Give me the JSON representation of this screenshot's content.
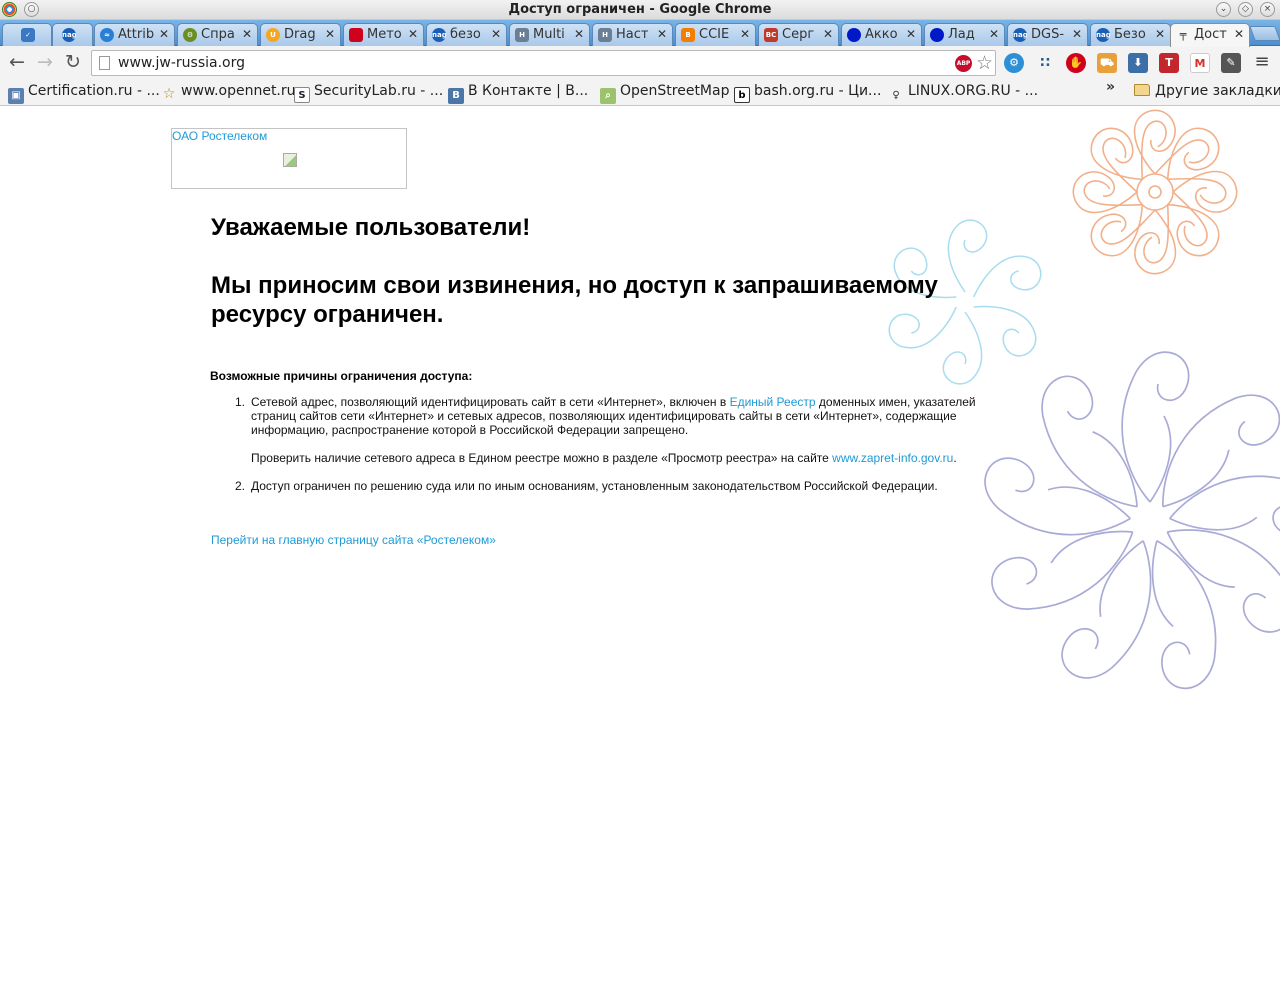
{
  "window": {
    "title": "Доступ ограничен - Google Chrome"
  },
  "tabs": [
    {
      "label": "",
      "icon": "checkmark-icon",
      "color": "#3b78c4"
    },
    {
      "label": "",
      "icon": "nagios-icon",
      "color": "#1a5fb4"
    },
    {
      "label": "Attrib",
      "icon": "wave-icon",
      "color": "#2a7fd4"
    },
    {
      "label": "Спра",
      "icon": "gear-icon",
      "color": "#6b8e23"
    },
    {
      "label": "Drag",
      "icon": "u-icon",
      "color": "#f5a623"
    },
    {
      "label": "Мето",
      "icon": "red-square-icon",
      "color": "#d0021b"
    },
    {
      "label": "безо",
      "icon": "nagios-icon",
      "color": "#1a5fb4"
    },
    {
      "label": "Multi",
      "icon": "h-icon",
      "color": "#6a7f96"
    },
    {
      "label": "Наст",
      "icon": "h-icon",
      "color": "#6a7f96"
    },
    {
      "label": "CCIE",
      "icon": "blogger-icon",
      "color": "#f57d00"
    },
    {
      "label": "Серг",
      "icon": "vc-icon",
      "color": "#c0392b"
    },
    {
      "label": "Акко",
      "icon": "blue-circle-icon",
      "color": "#0019c8"
    },
    {
      "label": "Лад",
      "icon": "blue-circle-icon",
      "color": "#0019c8"
    },
    {
      "label": "DGS-",
      "icon": "nagios-icon",
      "color": "#1a5fb4"
    },
    {
      "label": "Безо",
      "icon": "nagios-icon",
      "color": "#1a5fb4"
    },
    {
      "label": "Дост",
      "icon": "rostelecom-icon",
      "color": "#333333",
      "active": true
    }
  ],
  "toolbar": {
    "url": "www.jw-russia.org",
    "abp_label": "ABP"
  },
  "bookmarks": [
    {
      "label": "Certification.ru - ...",
      "icon": "cert-icon"
    },
    {
      "label": "www.opennet.ru",
      "icon": "star-icon"
    },
    {
      "label": "SecurityLab.ru - ...",
      "icon": "securitylab-icon"
    },
    {
      "label": "В Контакте | В...",
      "icon": "vk-icon"
    },
    {
      "label": "OpenStreetMap",
      "icon": "osm-icon"
    },
    {
      "label": "bash.org.ru - Ци...",
      "icon": "bash-icon"
    },
    {
      "label": "LINUX.ORG.RU - ...",
      "icon": "linux-icon"
    }
  ],
  "bookmarks_overflow": "»",
  "other_bookmarks": "Другие закладки",
  "page": {
    "logo_alt": "ОАО Ростелеком",
    "heading1": "Уважаемые пользователи!",
    "heading2_line1": "Мы приносим свои извинения, но доступ к запрашиваемому",
    "heading2_line2": "ресурсу ограничен.",
    "reasons_title": "Возможные причины ограничения доступа:",
    "reason1": {
      "num": "1.",
      "pre": "Сетевой адрес, позволяющий идентифицировать сайт в сети «Интернет», включен в ",
      "link": "Единый Реестр",
      "post_line1": " доменных имен, указателей",
      "line2": "страниц сайтов сети «Интернет» и сетевых адресов, позволяющих идентифицировать сайты в сети «Интернет», содержащие",
      "line3": "информацию, распространение которой в Российской Федерации запрещено.",
      "check_pre": "Проверить наличие сетевого адреса в Едином реестре можно в разделе «Просмотр реестра» на сайте ",
      "check_link": "www.zapret-info.gov.ru",
      "check_post": "."
    },
    "reason2": {
      "num": "2.",
      "text": "Доступ ограничен  по решению суда или по иным основаниям, установленным законодательством Российской Федерации."
    },
    "home_link": "Перейти на главную страницу сайта «Ростелеком»"
  },
  "colors": {
    "link": "#1e9ad6",
    "ornament_orange": "#f2b08a",
    "ornament_cyan": "#a9dcef",
    "ornament_violet": "#a9abd6"
  }
}
